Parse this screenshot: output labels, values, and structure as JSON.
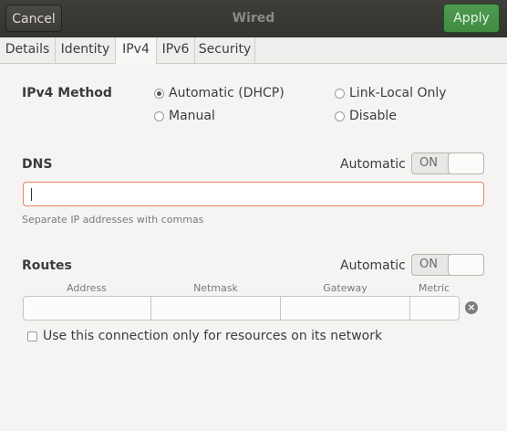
{
  "header": {
    "cancel_label": "Cancel",
    "title": "Wired",
    "apply_label": "Apply"
  },
  "tabs": [
    {
      "label": "Details",
      "active": false
    },
    {
      "label": "Identity",
      "active": false
    },
    {
      "label": "IPv4",
      "active": true
    },
    {
      "label": "IPv6",
      "active": false
    },
    {
      "label": "Security",
      "active": false
    }
  ],
  "ipv4": {
    "method_label": "IPv4 Method",
    "options": [
      {
        "label": "Automatic (DHCP)",
        "checked": true
      },
      {
        "label": "Link-Local Only",
        "checked": false
      },
      {
        "label": "Manual",
        "checked": false
      },
      {
        "label": "Disable",
        "checked": false
      }
    ]
  },
  "dns": {
    "label": "DNS",
    "automatic_label": "Automatic",
    "switch_text": "ON",
    "value": "",
    "hint": "Separate IP addresses with commas"
  },
  "routes": {
    "label": "Routes",
    "automatic_label": "Automatic",
    "switch_text": "ON",
    "columns": [
      "Address",
      "Netmask",
      "Gateway",
      "Metric"
    ],
    "clear_icon": "clear-icon"
  },
  "only_local": {
    "label": "Use this connection only for resources on its network",
    "checked": false
  },
  "colors": {
    "accent_green": "#4e9a4f",
    "focus_border": "#e8876a",
    "titlebar": "#3a3935"
  }
}
